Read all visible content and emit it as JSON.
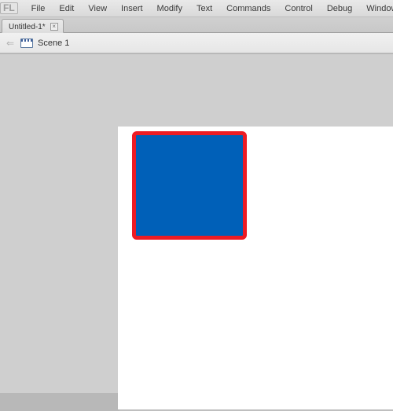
{
  "app_badge": "FL",
  "menu": {
    "items": [
      "File",
      "Edit",
      "View",
      "Insert",
      "Modify",
      "Text",
      "Commands",
      "Control",
      "Debug",
      "Window"
    ]
  },
  "tabs": {
    "active": {
      "label": "Untitled-1*",
      "close_glyph": "×"
    }
  },
  "scenebar": {
    "back_glyph": "⇐",
    "scene_label": "Scene 1"
  },
  "stage": {
    "bg": "#ffffff",
    "shape": {
      "fill": "#0060b8",
      "stroke": "#ed1c24"
    }
  }
}
